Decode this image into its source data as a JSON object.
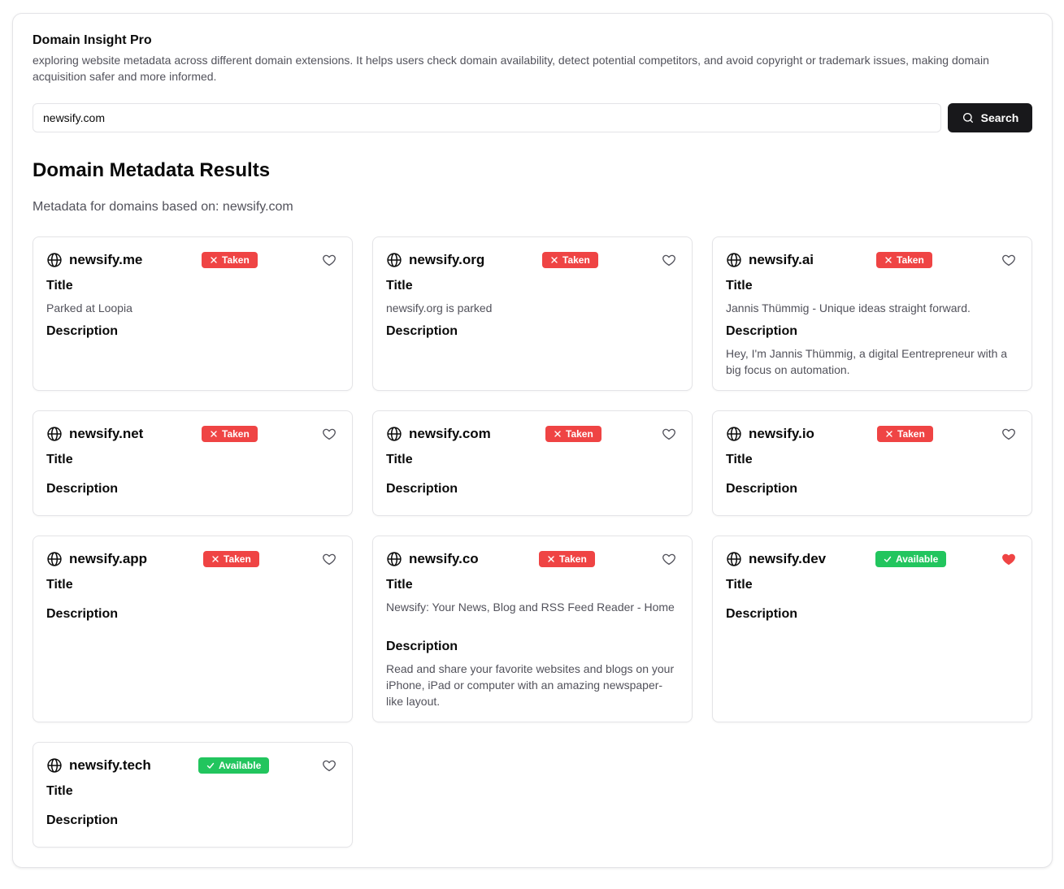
{
  "app": {
    "title": "Domain Insight Pro",
    "description": "exploring website metadata across different domain extensions. It helps users check domain availability, detect potential competitors, and avoid copyright or trademark issues, making domain acquisition safer and more informed."
  },
  "search": {
    "value": "newsify.com",
    "button_label": "Search"
  },
  "results": {
    "heading": "Domain Metadata Results",
    "subtitle": "Metadata for domains based on: newsify.com",
    "title_label": "Title",
    "description_label": "Description",
    "cards": [
      {
        "domain": "newsify.me",
        "status": "Taken",
        "status_type": "taken",
        "favorite": false,
        "title": "Parked at Loopia",
        "description": ""
      },
      {
        "domain": "newsify.org",
        "status": "Taken",
        "status_type": "taken",
        "favorite": false,
        "title": "newsify.org is parked",
        "description": ""
      },
      {
        "domain": "newsify.ai",
        "status": "Taken",
        "status_type": "taken",
        "favorite": false,
        "title": "Jannis Thümmig - Unique ideas straight forward.",
        "description": "Hey, I'm Jannis Thümmig, a digital Eentrepreneur with a big focus on automation."
      },
      {
        "domain": "newsify.net",
        "status": "Taken",
        "status_type": "taken",
        "favorite": false,
        "title": "",
        "description": ""
      },
      {
        "domain": "newsify.com",
        "status": "Taken",
        "status_type": "taken",
        "favorite": false,
        "title": "",
        "description": ""
      },
      {
        "domain": "newsify.io",
        "status": "Taken",
        "status_type": "taken",
        "favorite": false,
        "title": "",
        "description": ""
      },
      {
        "domain": "newsify.app",
        "status": "Taken",
        "status_type": "taken",
        "favorite": false,
        "title": "",
        "description": ""
      },
      {
        "domain": "newsify.co",
        "status": "Taken",
        "status_type": "taken",
        "favorite": false,
        "title": "Newsify: Your News, Blog and RSS Feed Reader - Home",
        "description": "Read and share your favorite websites and blogs on your iPhone, iPad or computer with an amazing newspaper-like layout."
      },
      {
        "domain": "newsify.dev",
        "status": "Available",
        "status_type": "available",
        "favorite": true,
        "title": "",
        "description": ""
      },
      {
        "domain": "newsify.tech",
        "status": "Available",
        "status_type": "available",
        "favorite": false,
        "title": "",
        "description": ""
      }
    ]
  },
  "colors": {
    "taken": "#ef4444",
    "available": "#22c55e",
    "favorite": "#ef4444",
    "primary_button": "#18181b"
  }
}
